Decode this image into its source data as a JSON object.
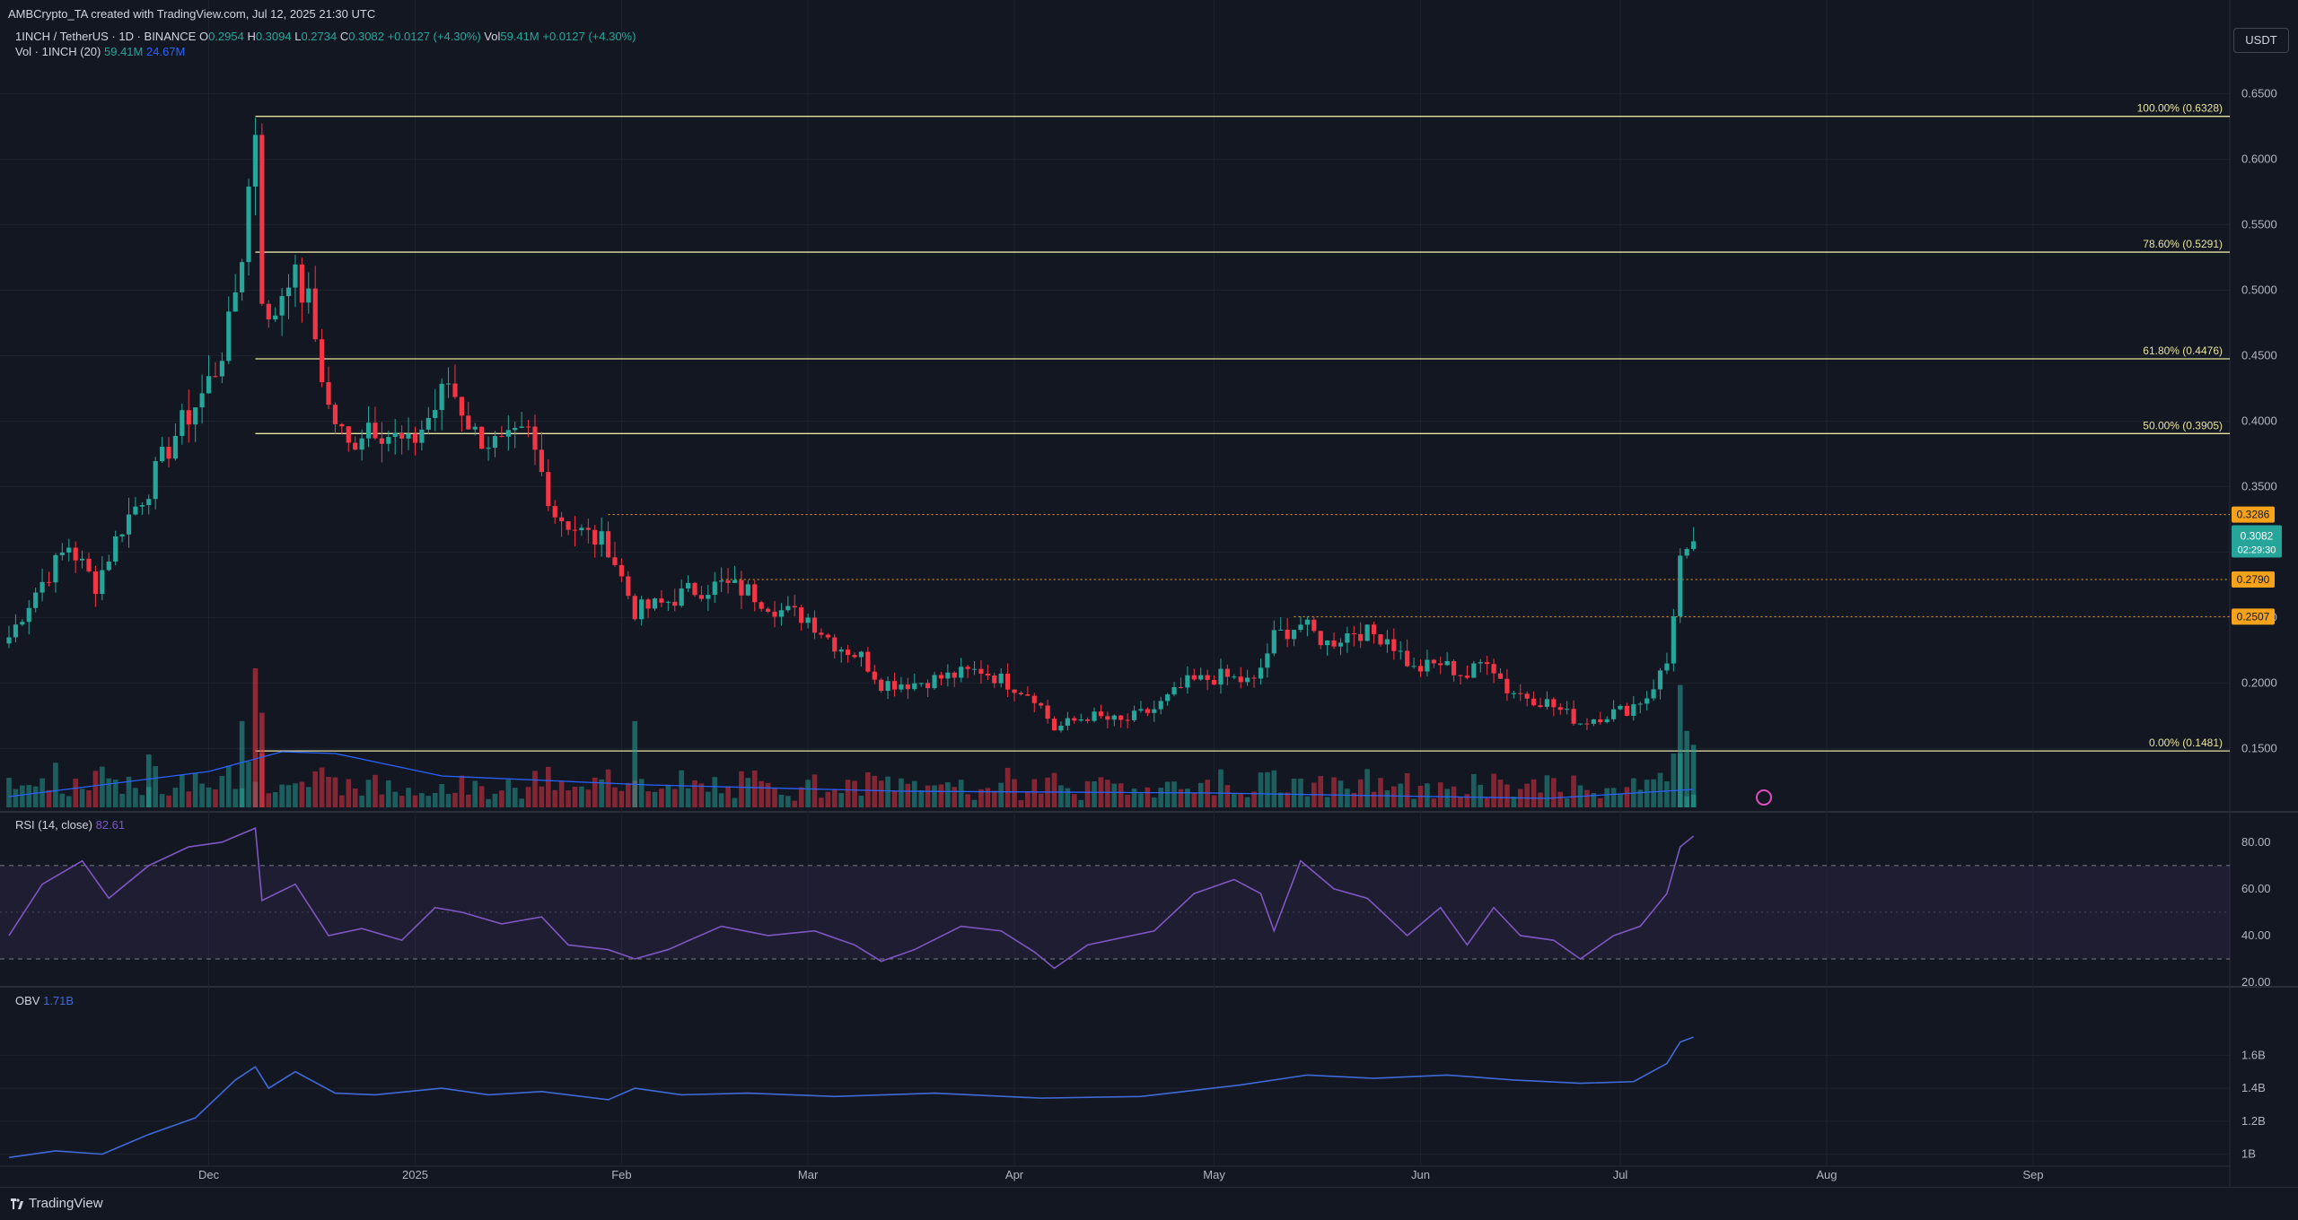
{
  "header": "AMBCrypto_TA created with TradingView.com, Jul 12, 2025 21:30 UTC",
  "symbol": {
    "name": "1INCH / TetherUS · 1D · BINANCE",
    "ohlc": [
      {
        "k": "O",
        "v": "0.2954"
      },
      {
        "k": "H",
        "v": "0.3094"
      },
      {
        "k": "L",
        "v": "0.2734"
      },
      {
        "k": "C",
        "v": "0.3082"
      }
    ],
    "change": "+0.0127 (+4.30%)",
    "vol_label": "Vol",
    "vol_value": "59.41M",
    "vol_change": "+0.0127 (+4.30%)"
  },
  "volume_indicator": {
    "label": "Vol · 1INCH (20)",
    "value": "59.41M",
    "ma": "24.67M"
  },
  "rsi_indicator": {
    "label": "RSI (14, close)",
    "value": "82.61"
  },
  "obv_indicator": {
    "label": "OBV",
    "value": "1.71B"
  },
  "currency_button": "USDT",
  "footer_brand": "TradingView",
  "colors": {
    "background": "#131722",
    "up": "#26a69a",
    "down": "#f23645",
    "fib": "#e8e3a3",
    "level": "#f7a21b",
    "rsi": "#7e57c2",
    "obv": "#3f6ad8",
    "vol_ma": "#2962ff",
    "grid": "#1e222d"
  },
  "chart_data": [
    {
      "type": "candlestick",
      "title": "1INCH / TetherUS · 1D · BINANCE",
      "x_range": [
        "2024-11-01",
        "2025-09-30"
      ],
      "ylim": [
        0.105,
        0.66
      ],
      "y_ticks": [
        "0.6500",
        "0.6000",
        "0.5500",
        "0.5000",
        "0.4500",
        "0.4000",
        "0.3500",
        "0.3000",
        "0.2500",
        "0.2000",
        "0.1500"
      ],
      "x_ticks": [
        {
          "label": "Dec",
          "date": "2024-12-01"
        },
        {
          "label": "2025",
          "date": "2025-01-01"
        },
        {
          "label": "Feb",
          "date": "2025-02-01"
        },
        {
          "label": "Mar",
          "date": "2025-03-01"
        },
        {
          "label": "Apr",
          "date": "2025-04-01"
        },
        {
          "label": "May",
          "date": "2025-05-01"
        },
        {
          "label": "Jun",
          "date": "2025-06-01"
        },
        {
          "label": "Jul",
          "date": "2025-07-01"
        },
        {
          "label": "Aug",
          "date": "2025-08-01"
        },
        {
          "label": "Sep",
          "date": "2025-09-01"
        }
      ],
      "fib_start_date": "2024-12-08",
      "fib_levels": [
        {
          "label": "100.00% (0.6328)",
          "value": 0.6328
        },
        {
          "label": "78.60% (0.5291)",
          "value": 0.5291
        },
        {
          "label": "61.80% (0.4476)",
          "value": 0.4476
        },
        {
          "label": "50.00% (0.3905)",
          "value": 0.3905
        },
        {
          "label": "0.00% (0.1481)",
          "value": 0.1481
        }
      ],
      "horizontal_levels": [
        {
          "label": "0.3286",
          "value": 0.3286,
          "start": "2025-01-30"
        },
        {
          "label": "0.2790",
          "value": 0.279,
          "start": "2025-02-16"
        },
        {
          "label": "0.2507",
          "value": 0.2507,
          "start": "2025-05-13"
        }
      ],
      "last_price": {
        "value": 0.3082,
        "label": "0.3082",
        "countdown": "02:29:30"
      },
      "price_path": [
        [
          "2024-11-01",
          0.235
        ],
        [
          "2024-11-05",
          0.27
        ],
        [
          "2024-11-10",
          0.305
        ],
        [
          "2024-11-14",
          0.275
        ],
        [
          "2024-11-18",
          0.32
        ],
        [
          "2024-11-22",
          0.35
        ],
        [
          "2024-11-26",
          0.39
        ],
        [
          "2024-11-30",
          0.42
        ],
        [
          "2024-12-02",
          0.44
        ],
        [
          "2024-12-04",
          0.47
        ],
        [
          "2024-12-06",
          0.53
        ],
        [
          "2024-12-08",
          0.625
        ],
        [
          "2024-12-09",
          0.5
        ],
        [
          "2024-12-10",
          0.47
        ],
        [
          "2024-12-13",
          0.515
        ],
        [
          "2024-12-16",
          0.49
        ],
        [
          "2024-12-19",
          0.41
        ],
        [
          "2024-12-22",
          0.38
        ],
        [
          "2024-12-25",
          0.4
        ],
        [
          "2024-12-28",
          0.39
        ],
        [
          "2024-12-31",
          0.38
        ],
        [
          "2025-01-04",
          0.41
        ],
        [
          "2025-01-06",
          0.43
        ],
        [
          "2025-01-10",
          0.39
        ],
        [
          "2025-01-14",
          0.38
        ],
        [
          "2025-01-18",
          0.39
        ],
        [
          "2025-01-22",
          0.33
        ],
        [
          "2025-01-26",
          0.315
        ],
        [
          "2025-01-30",
          0.305
        ],
        [
          "2025-02-03",
          0.255
        ],
        [
          "2025-02-07",
          0.26
        ],
        [
          "2025-02-11",
          0.27
        ],
        [
          "2025-02-16",
          0.275
        ],
        [
          "2025-02-20",
          0.27
        ],
        [
          "2025-02-25",
          0.255
        ],
        [
          "2025-03-01",
          0.25
        ],
        [
          "2025-03-05",
          0.23
        ],
        [
          "2025-03-09",
          0.22
        ],
        [
          "2025-03-12",
          0.2
        ],
        [
          "2025-03-17",
          0.2
        ],
        [
          "2025-03-22",
          0.205
        ],
        [
          "2025-03-27",
          0.21
        ],
        [
          "2025-03-31",
          0.2
        ],
        [
          "2025-04-04",
          0.19
        ],
        [
          "2025-04-07",
          0.165
        ],
        [
          "2025-04-12",
          0.175
        ],
        [
          "2025-04-17",
          0.17
        ],
        [
          "2025-04-22",
          0.18
        ],
        [
          "2025-04-27",
          0.2
        ],
        [
          "2025-05-02",
          0.205
        ],
        [
          "2025-05-07",
          0.2
        ],
        [
          "2025-05-10",
          0.235
        ],
        [
          "2025-05-14",
          0.245
        ],
        [
          "2025-05-18",
          0.23
        ],
        [
          "2025-05-22",
          0.24
        ],
        [
          "2025-05-27",
          0.235
        ],
        [
          "2025-05-31",
          0.21
        ],
        [
          "2025-06-04",
          0.215
        ],
        [
          "2025-06-08",
          0.205
        ],
        [
          "2025-06-11",
          0.22
        ],
        [
          "2025-06-14",
          0.195
        ],
        [
          "2025-06-20",
          0.185
        ],
        [
          "2025-06-25",
          0.17
        ],
        [
          "2025-06-28",
          0.175
        ],
        [
          "2025-07-02",
          0.18
        ],
        [
          "2025-07-05",
          0.19
        ],
        [
          "2025-07-08",
          0.215
        ],
        [
          "2025-07-10",
          0.295
        ],
        [
          "2025-07-11",
          0.2955
        ],
        [
          "2025-07-12",
          0.3082
        ]
      ]
    },
    {
      "type": "bar",
      "title": "Vol · 1INCH (20)",
      "note": "volume histogram at bottom of price pane",
      "spikes": [
        [
          "2024-12-08",
          1.0
        ],
        [
          "2024-12-06",
          0.62
        ],
        [
          "2024-12-09",
          0.68
        ],
        [
          "2024-11-22",
          0.38
        ],
        [
          "2025-02-03",
          0.62
        ],
        [
          "2025-07-10",
          0.88
        ],
        [
          "2025-07-11",
          0.55
        ],
        [
          "2025-07-12",
          0.45
        ]
      ]
    },
    {
      "type": "line",
      "title": "RSI (14, close)",
      "ylim": [
        20,
        88
      ],
      "y_ticks": [
        "80.00",
        "60.00",
        "40.00",
        "20.00"
      ],
      "bands": [
        30,
        50,
        70
      ],
      "values": [
        [
          "2024-11-01",
          40
        ],
        [
          "2024-11-06",
          62
        ],
        [
          "2024-11-12",
          72
        ],
        [
          "2024-11-16",
          56
        ],
        [
          "2024-11-22",
          70
        ],
        [
          "2024-11-28",
          78
        ],
        [
          "2024-12-03",
          80
        ],
        [
          "2024-12-08",
          86
        ],
        [
          "2024-12-09",
          55
        ],
        [
          "2024-12-14",
          62
        ],
        [
          "2024-12-19",
          40
        ],
        [
          "2024-12-24",
          43
        ],
        [
          "2024-12-30",
          38
        ],
        [
          "2025-01-04",
          52
        ],
        [
          "2025-01-08",
          50
        ],
        [
          "2025-01-14",
          45
        ],
        [
          "2025-01-20",
          48
        ],
        [
          "2025-01-24",
          36
        ],
        [
          "2025-01-30",
          34
        ],
        [
          "2025-02-03",
          30
        ],
        [
          "2025-02-08",
          34
        ],
        [
          "2025-02-16",
          44
        ],
        [
          "2025-02-23",
          40
        ],
        [
          "2025-03-02",
          42
        ],
        [
          "2025-03-08",
          36
        ],
        [
          "2025-03-12",
          29
        ],
        [
          "2025-03-17",
          34
        ],
        [
          "2025-03-24",
          44
        ],
        [
          "2025-03-30",
          42
        ],
        [
          "2025-04-04",
          33
        ],
        [
          "2025-04-07",
          26
        ],
        [
          "2025-04-12",
          36
        ],
        [
          "2025-04-22",
          42
        ],
        [
          "2025-04-28",
          58
        ],
        [
          "2025-05-04",
          64
        ],
        [
          "2025-05-08",
          58
        ],
        [
          "2025-05-10",
          42
        ],
        [
          "2025-05-14",
          72
        ],
        [
          "2025-05-19",
          60
        ],
        [
          "2025-05-24",
          56
        ],
        [
          "2025-05-30",
          40
        ],
        [
          "2025-06-04",
          52
        ],
        [
          "2025-06-08",
          36
        ],
        [
          "2025-06-12",
          52
        ],
        [
          "2025-06-16",
          40
        ],
        [
          "2025-06-21",
          38
        ],
        [
          "2025-06-25",
          30
        ],
        [
          "2025-06-30",
          40
        ],
        [
          "2025-07-04",
          44
        ],
        [
          "2025-07-08",
          58
        ],
        [
          "2025-07-10",
          78
        ],
        [
          "2025-07-12",
          82.61
        ]
      ]
    },
    {
      "type": "line",
      "title": "OBV",
      "ylim": [
        0.9,
        1.95
      ],
      "y_ticks": [
        "1.6B",
        "1.4B",
        "1.2B",
        "1B"
      ],
      "values": [
        [
          "2024-11-01",
          0.98
        ],
        [
          "2024-11-08",
          1.02
        ],
        [
          "2024-11-15",
          1.0
        ],
        [
          "2024-11-22",
          1.12
        ],
        [
          "2024-11-29",
          1.22
        ],
        [
          "2024-12-05",
          1.45
        ],
        [
          "2024-12-08",
          1.53
        ],
        [
          "2024-12-10",
          1.4
        ],
        [
          "2024-12-14",
          1.5
        ],
        [
          "2024-12-20",
          1.37
        ],
        [
          "2024-12-26",
          1.36
        ],
        [
          "2025-01-05",
          1.4
        ],
        [
          "2025-01-12",
          1.36
        ],
        [
          "2025-01-20",
          1.38
        ],
        [
          "2025-01-30",
          1.33
        ],
        [
          "2025-02-03",
          1.4
        ],
        [
          "2025-02-10",
          1.36
        ],
        [
          "2025-02-20",
          1.37
        ],
        [
          "2025-03-05",
          1.35
        ],
        [
          "2025-03-20",
          1.37
        ],
        [
          "2025-04-05",
          1.34
        ],
        [
          "2025-04-20",
          1.35
        ],
        [
          "2025-05-05",
          1.42
        ],
        [
          "2025-05-15",
          1.48
        ],
        [
          "2025-05-25",
          1.46
        ],
        [
          "2025-06-05",
          1.48
        ],
        [
          "2025-06-15",
          1.45
        ],
        [
          "2025-06-25",
          1.43
        ],
        [
          "2025-07-03",
          1.44
        ],
        [
          "2025-07-08",
          1.55
        ],
        [
          "2025-07-10",
          1.68
        ],
        [
          "2025-07-12",
          1.71
        ]
      ]
    }
  ]
}
